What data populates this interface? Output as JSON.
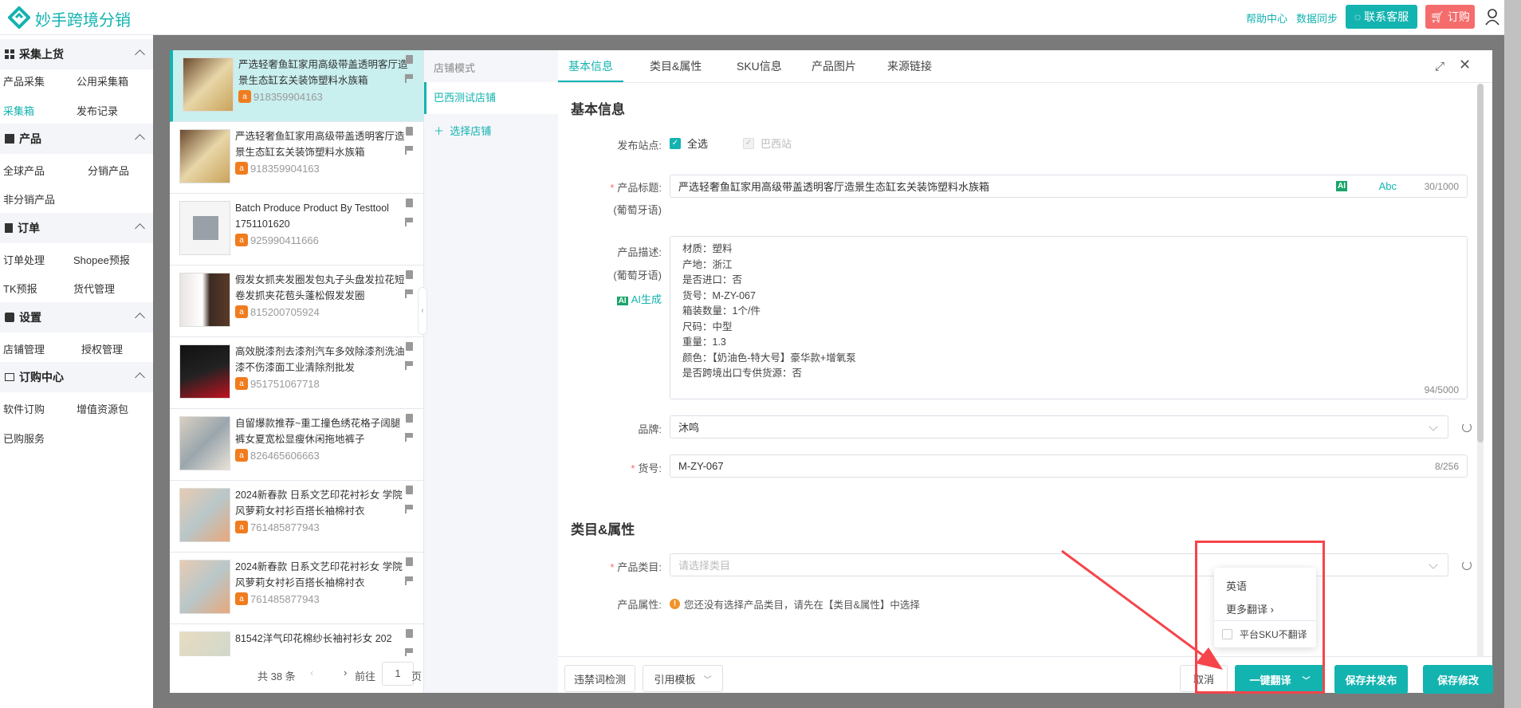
{
  "header": {
    "brand": "妙手跨境分销",
    "help": "帮助中心",
    "sync": "数据同步",
    "contact": "联系客服",
    "order": "订购",
    "colors": {
      "accent": "#13b3b0",
      "order": "#f56c6c"
    }
  },
  "sidebar": {
    "sections": [
      {
        "title": "采集上货",
        "icon": "grid-icon",
        "items": [
          "产品采集",
          "公用采集箱",
          "采集箱",
          "发布记录"
        ],
        "active": "采集箱"
      },
      {
        "title": "产品",
        "icon": "edit-icon",
        "items": [
          "全球产品",
          "分销产品",
          "非分销产品"
        ]
      },
      {
        "title": "订单",
        "icon": "document-icon",
        "items": [
          "订单处理",
          "Shopee预报",
          "TK预报",
          "货代管理"
        ]
      },
      {
        "title": "设置",
        "icon": "settings-icon",
        "items": [
          "店铺管理",
          "授权管理"
        ]
      },
      {
        "title": "订购中心",
        "icon": "card-icon",
        "items": [
          "软件订购",
          "增值资源包",
          "已购服务"
        ]
      }
    ]
  },
  "products": [
    {
      "title": "严选轻奢鱼缸家用高级带盖透明客厅造景生态缸玄关装饰塑料水族箱",
      "id": "918359904163",
      "active": true
    },
    {
      "title": "严选轻奢鱼缸家用高级带盖透明客厅造景生态缸玄关装饰塑料水族箱",
      "id": "918359904163"
    },
    {
      "title": "Batch Produce Product By Testtool 1751101620",
      "id": "925990411666",
      "noimage": true
    },
    {
      "title": "假发女抓夹发圈发包丸子头盘发拉花短卷发抓夹花苞头蓬松假发发圈",
      "id": "815200705924"
    },
    {
      "title": "高效脱漆剂去漆剂汽车多效除漆剂洗油漆不伤漆面工业清除剂批发",
      "id": "951751067718"
    },
    {
      "title": "自留爆款推荐~重工撞色绣花格子阔腿裤女夏宽松显瘦休闲拖地裤子",
      "id": "826465606663"
    },
    {
      "title": "2024新春款 日系文艺印花衬衫女 学院风萝莉女衬衫百搭长袖棉衬衣",
      "id": "761485877943"
    },
    {
      "title": "2024新春款 日系文艺印花衬衫女 学院风萝莉女衬衫百搭长袖棉衬衣",
      "id": "761485877943"
    },
    {
      "title": "81542洋气印花棉纱长袖衬衫女 202",
      "id": ""
    }
  ],
  "pager": {
    "total": "共 38 条",
    "goto": "前往",
    "page": "1",
    "unit": "页"
  },
  "stores": {
    "mode": "店铺模式",
    "current": "巴西测试店铺",
    "add": "选择店铺"
  },
  "tabs": [
    "基本信息",
    "类目&属性",
    "SKU信息",
    "产品图片",
    "来源链接"
  ],
  "form": {
    "basic_heading": "基本信息",
    "site_label": "发布站点:",
    "select_all": "全选",
    "site": "巴西站",
    "title_label": "产品标题:",
    "lang": "(葡萄牙语)",
    "title_value": "严选轻奢鱼缸家用高级带盖透明客厅造景生态缸玄关装饰塑料水族箱",
    "ai": "AI",
    "abc": "Abc",
    "title_count": "30/1000",
    "desc_label": "产品描述:",
    "ai_gen": "AI生成",
    "desc_lines": [
      "材质：塑料",
      "产地：浙江",
      "是否进口：否",
      "货号：M-ZY-067",
      "箱装数量：1个/件",
      "尺码：中型",
      "重量：1.3",
      "颜色：【奶油色-特大号】豪华款+增氧泵",
      "是否跨境出口专供货源：否"
    ],
    "desc_count": "94/5000",
    "brand_label": "品牌:",
    "brand_value": "沐鸣",
    "sku_label": "货号:",
    "sku_value": "M-ZY-067",
    "sku_count": "8/256",
    "cat_heading": "类目&属性",
    "cat_label": "产品类目:",
    "cat_placeholder": "请选择类目",
    "attr_label": "产品属性:",
    "attr_msg": "您还没有选择产品类目，请先在【类目&属性】中选择"
  },
  "footer": {
    "check": "违禁词检测",
    "template": "引用模板",
    "cancel": "取消",
    "translate": "一键翻译",
    "save_publish": "保存并发布",
    "save": "保存修改"
  },
  "translate_menu": {
    "english": "英语",
    "more": "更多翻译",
    "no_sku": "平台SKU不翻译"
  },
  "annotation_color": "#f5454a"
}
